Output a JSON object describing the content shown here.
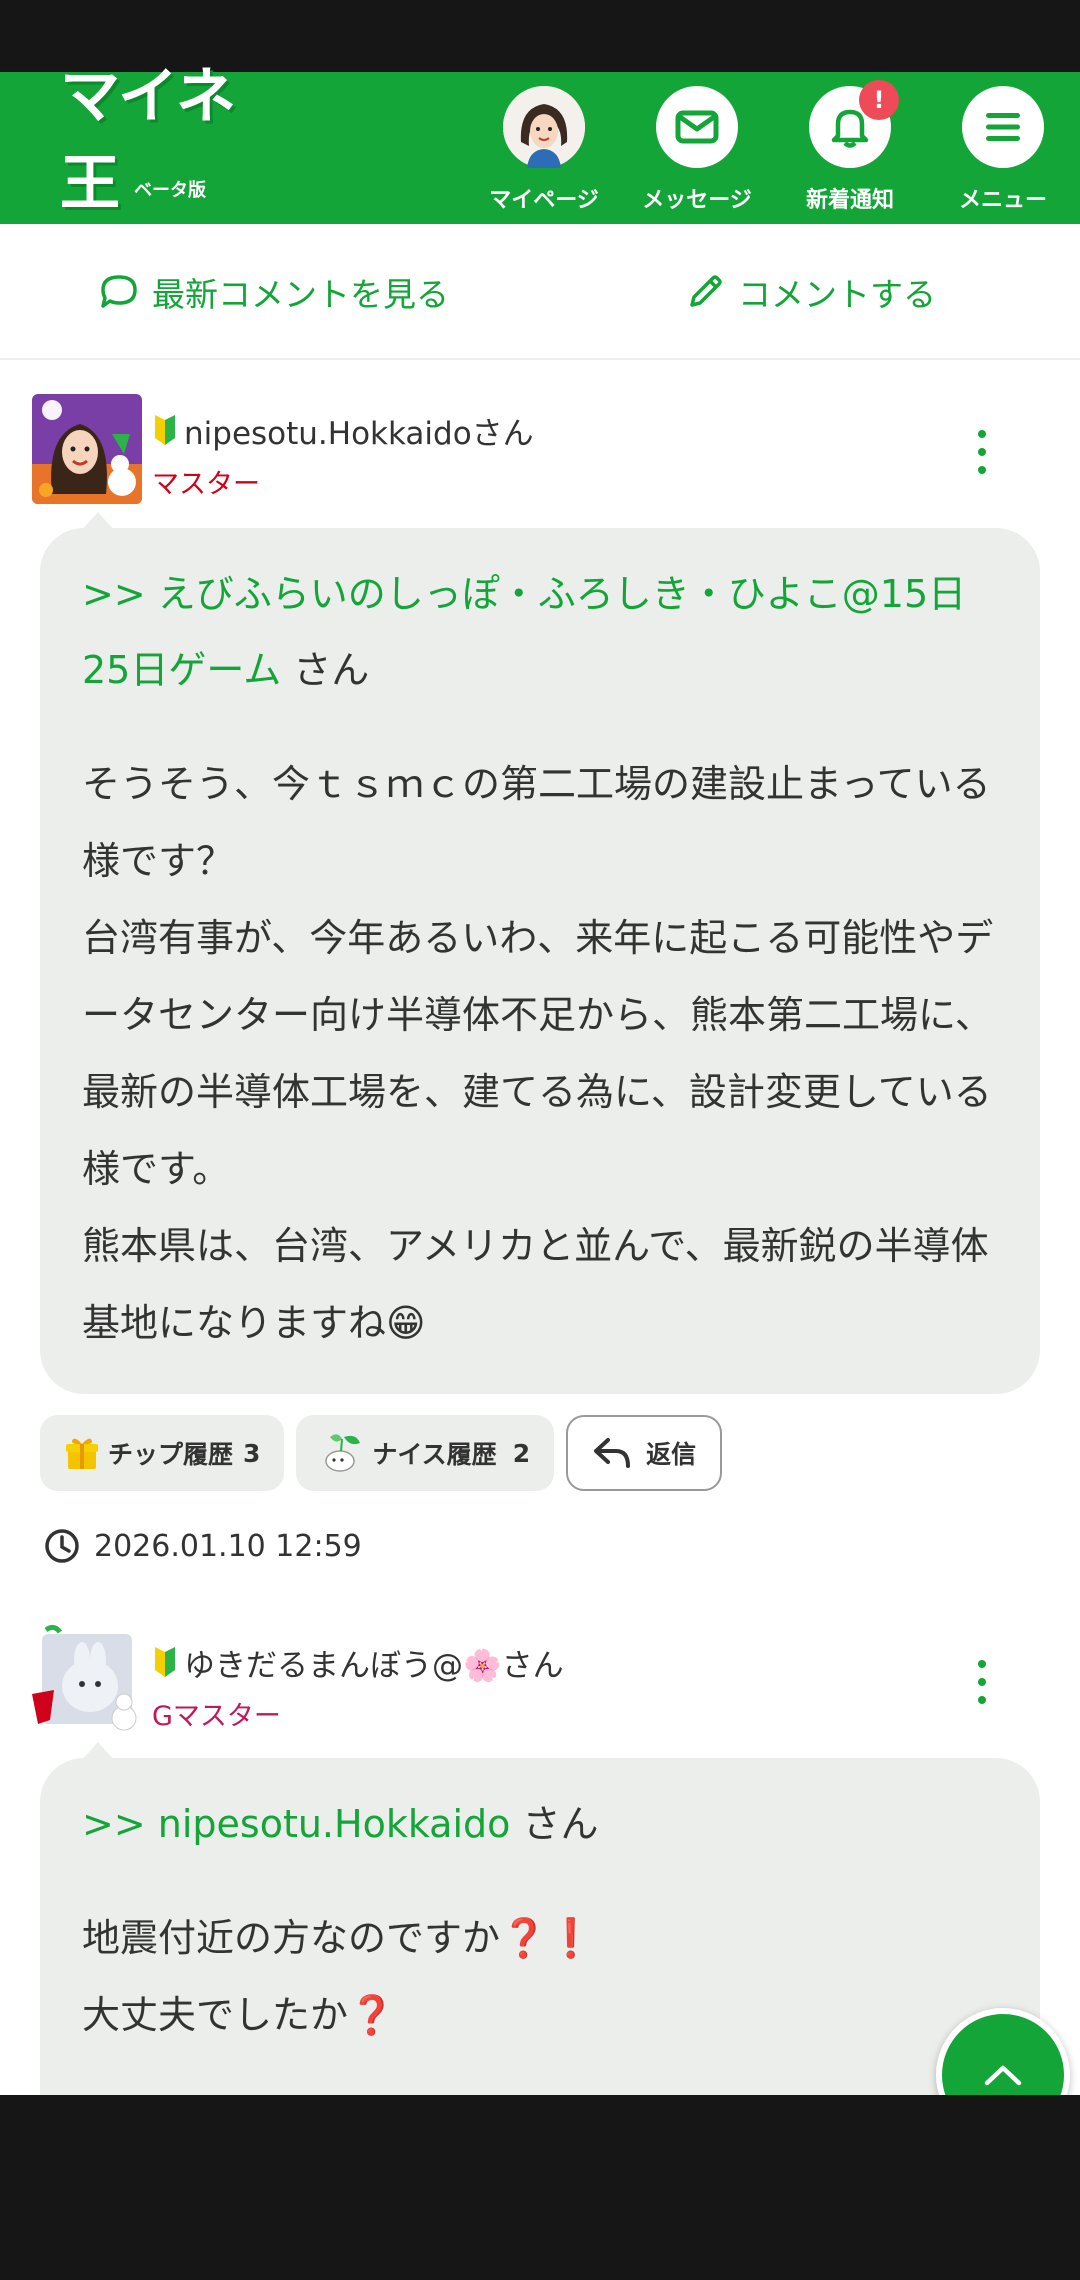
{
  "header": {
    "logo_text": "マイネ王",
    "logo_sub": "ベータ版",
    "nav": {
      "mypage": "マイページ",
      "messages": "メッセージ",
      "notifications": "新着通知",
      "notification_badge": "!",
      "menu": "メニュー"
    },
    "brand_color": "#13a538"
  },
  "actions": {
    "latest_comments": "最新コメントを見る",
    "comment": "コメントする"
  },
  "posts": [
    {
      "username": "nipesotu.Hokkaidoさん",
      "rank": "マスター",
      "rank_color": "#d0021b",
      "reply_to": ">> えびふらいのしっぽ・ふろしき・ひよこ@15日25日ゲーム",
      "reply_suffix": " さん",
      "body": "そうそう、今ｔｓｍｃの第二工場の建設止まっている様です？\n台湾有事が、今年あるいわ、来年に起こる可能性やデータセンター向け半導体不足から、熊本第二工場に、最新の半導体工場を、建てる為に、設計変更している様です。\n熊本県は、台湾、アメリカと並んで、最新鋭の半導体基地になりますね😁",
      "tip_label": "チップ履歴",
      "tip_count": "3",
      "nice_label": "ナイス履歴",
      "nice_count": "2",
      "reply_label": "返信",
      "timestamp": "2026.01.10 12:59"
    },
    {
      "username": "ゆきだるまんぼう@🌸さん",
      "rank": "Gマスター",
      "rank_color": "#c2185b",
      "reply_to": ">> nipesotu.Hokkaido",
      "reply_suffix": " さん",
      "body": "地震付近の方なのですか❓❗\n大丈夫でしたか❓"
    }
  ]
}
